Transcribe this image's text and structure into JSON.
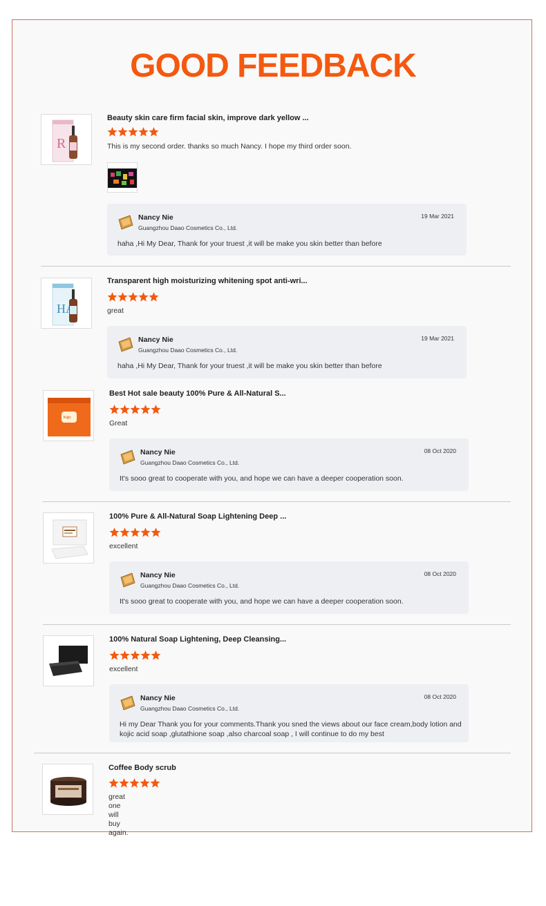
{
  "page": {
    "title": "GOOD FEEDBACK"
  },
  "colors": {
    "accent": "#f4590f",
    "star": "#f4590f",
    "border": "#c9735a"
  },
  "reviews": [
    {
      "product_title": "Beauty skin care firm facial skin, improve dark yellow ...",
      "rating": 5,
      "comment": "This is my second order. thanks so much Nancy. I hope my third order soon.",
      "reply": {
        "name": "Nancy Nie",
        "company": "Guangzhou Daao Cosmetics Co., Ltd.",
        "date": "19 Mar 2021",
        "text": "haha ,Hi My Dear, Thank for your truest ,it will be make you skin better than before"
      }
    },
    {
      "product_title": "Transparent high moisturizing whitening spot anti-wri...",
      "rating": 5,
      "comment": "great",
      "reply": {
        "name": "Nancy Nie",
        "company": "Guangzhou Daao Cosmetics Co., Ltd.",
        "date": "19 Mar 2021",
        "text": "haha ,Hi My Dear, Thank for your truest ,it will be make you skin better than before"
      }
    },
    {
      "product_title": "Best Hot sale beauty 100% Pure & All-Natural S...",
      "rating": 5,
      "comment": "Great",
      "reply": {
        "name": "Nancy Nie",
        "company": "Guangzhou Daao Cosmetics Co., Ltd.",
        "date": "08 Oct 2020",
        "text": "It's sooo great to cooperate with you,  and hope we can have a deeper cooperation soon."
      }
    },
    {
      "product_title": "100% Pure & All-Natural Soap Lightening Deep ...",
      "rating": 5,
      "comment": "excellent",
      "reply": {
        "name": "Nancy Nie",
        "company": "Guangzhou Daao Cosmetics Co., Ltd.",
        "date": "08 Oct 2020",
        "text": "It's sooo great to cooperate with you,  and hope we can have a deeper cooperation soon."
      }
    },
    {
      "product_title": "100% Natural Soap Lightening, Deep Cleansing...",
      "rating": 5,
      "comment": "excellent",
      "reply": {
        "name": "Nancy Nie",
        "company": "Guangzhou Daao Cosmetics Co., Ltd.",
        "date": "08 Oct 2020",
        "text": "Hi my Dear Thank you for your comments.Thank you sned the views about  our face cream,body lotion and kojic acid soap ,glutathione soap ,also charcoal soap ,  I will continue to do my best"
      }
    },
    {
      "product_title": "Coffee Body scrub",
      "rating": 5,
      "comment": "great one\nwill buy again."
    }
  ]
}
